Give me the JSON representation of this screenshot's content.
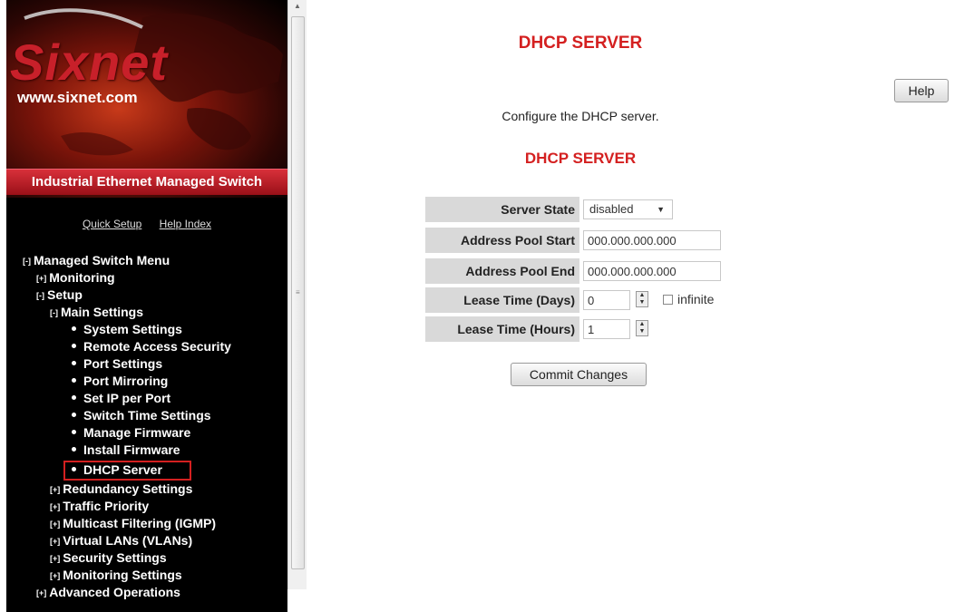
{
  "branding": {
    "logo_text": "Sixnet",
    "site_url": "www.sixnet.com",
    "banner_title": "Industrial Ethernet Managed Switch"
  },
  "quick_links": [
    "Quick Setup",
    "Help Index"
  ],
  "menu": {
    "root": {
      "toggle": "[-]",
      "label": "Managed Switch Menu"
    },
    "monitoring": {
      "toggle": "[+]",
      "label": "Monitoring"
    },
    "setup": {
      "toggle": "[-]",
      "label": "Setup"
    },
    "main_settings": {
      "toggle": "[-]",
      "label": "Main Settings"
    },
    "main_settings_items": [
      "System Settings",
      "Remote Access Security",
      "Port Settings",
      "Port Mirroring",
      "Set IP per Port",
      "Switch Time Settings",
      "Manage Firmware",
      "Install Firmware",
      "DHCP Server"
    ],
    "setup_groups": [
      {
        "toggle": "[+]",
        "label": "Redundancy Settings"
      },
      {
        "toggle": "[+]",
        "label": "Traffic Priority"
      },
      {
        "toggle": "[+]",
        "label": "Multicast Filtering (IGMP)"
      },
      {
        "toggle": "[+]",
        "label": "Virtual LANs (VLANs)"
      },
      {
        "toggle": "[+]",
        "label": "Security Settings"
      },
      {
        "toggle": "[+]",
        "label": "Monitoring Settings"
      }
    ],
    "advanced": {
      "toggle": "[+]",
      "label": "Advanced Operations"
    },
    "selected_item": "DHCP Server"
  },
  "main": {
    "page_title": "DHCP SERVER",
    "help_label": "Help",
    "description": "Configure the DHCP server.",
    "section_title": "DHCP SERVER",
    "form": {
      "server_state": {
        "label": "Server State",
        "value": "disabled"
      },
      "pool_start": {
        "label": "Address Pool Start",
        "value": "000.000.000.000"
      },
      "pool_end": {
        "label": "Address Pool End",
        "value": "000.000.000.000"
      },
      "lease_days": {
        "label": "Lease Time (Days)",
        "value": "0",
        "infinite_label": "infinite",
        "infinite_checked": false
      },
      "lease_hours": {
        "label": "Lease Time (Hours)",
        "value": "1"
      }
    },
    "commit_label": "Commit Changes"
  },
  "colors": {
    "accent_red": "#d42020",
    "sidebar_bg": "#000000",
    "label_bg": "#d9d9d9"
  }
}
